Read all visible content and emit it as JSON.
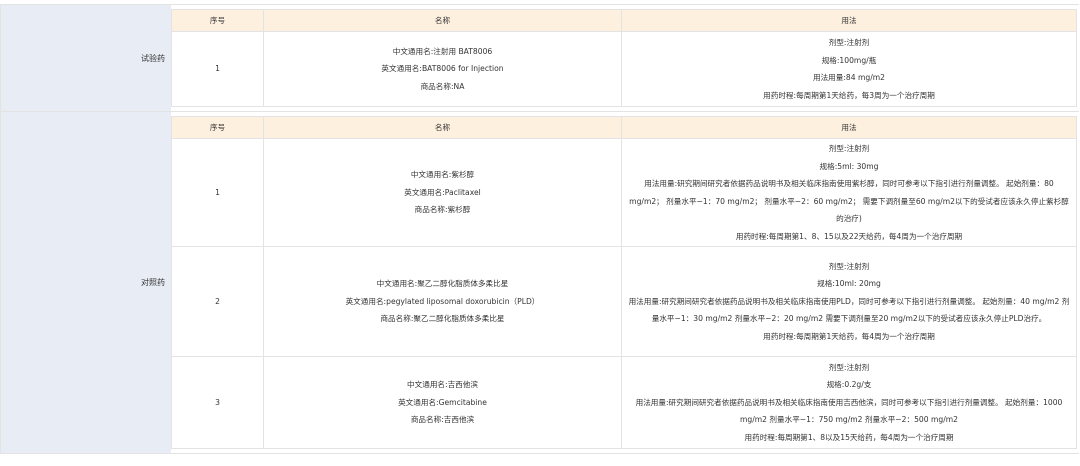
{
  "headers": {
    "no": "序号",
    "name": "名称",
    "usage": "用法"
  },
  "test_drug": {
    "label": "试验药",
    "rows": [
      {
        "no": "1",
        "name_lines": [
          "中文通用名:注射用 BAT8006",
          "英文通用名:BAT8006 for Injection",
          "商品名称:NA"
        ],
        "usage_lines": [
          "剂型:注射剂",
          "规格:100mg/瓶",
          "用法用量:84 mg/m2",
          "用药时程:每周期第1天给药，每3周为一个治疗周期"
        ]
      }
    ]
  },
  "control_drug": {
    "label": "对照药",
    "rows": [
      {
        "no": "1",
        "name_lines": [
          "中文通用名:紫杉醇",
          "英文通用名:Paclitaxel",
          "商品名称:紫杉醇"
        ],
        "usage_lines": [
          "剂型:注射剂",
          "规格:5ml: 30mg",
          "用法用量:研究期间研究者依据药品说明书及相关临床指南使用紫杉醇，同时可参考以下指引进行剂量调整。 起始剂量：80 mg/m2； 剂量水平−1：70 mg/m2； 剂量水平−2：60 mg/m2； 需要下调剂量至60 mg/m2以下的受试者应该永久停止紫杉醇的治疗)",
          "用药时程:每周期第1、8、15以及22天给药，每4周为一个治疗周期"
        ]
      },
      {
        "no": "2",
        "name_lines": [
          "中文通用名:聚乙二醇化脂质体多柔比星",
          "英文通用名:pegylated liposomal doxorubicin（PLD）",
          "商品名称:聚乙二醇化脂质体多柔比星"
        ],
        "usage_lines": [
          "剂型:注射剂",
          "规格:10ml: 20mg",
          "用法用量:研究期间研究者依据药品说明书及相关临床指南使用PLD，同时可参考以下指引进行剂量调整。 起始剂量：40 mg/m2 剂量水平−1：30 mg/m2 剂量水平−2：20 mg/m2 需要下调剂量至20 mg/m2以下的受试者应该永久停止PLD治疗。",
          "用药时程:每周期第1天给药，每4周为一个治疗周期"
        ]
      },
      {
        "no": "3",
        "name_lines": [
          "中文通用名:吉西他滨",
          "英文通用名:Gemcitabine",
          "商品名称:吉西他滨"
        ],
        "usage_lines": [
          "剂型:注射剂",
          "规格:0.2g/支",
          "用法用量:研究期间研究者依据药品说明书及相关临床指南使用吉西他滨，同时可参考以下指引进行剂量调整。 起始剂量：1000 mg/m2 剂量水平−1：750 mg/m2 剂量水平−2：500 mg/m2",
          "用药时程:每周期第1、8以及15天给药，每4周为一个治疗周期"
        ]
      }
    ]
  }
}
